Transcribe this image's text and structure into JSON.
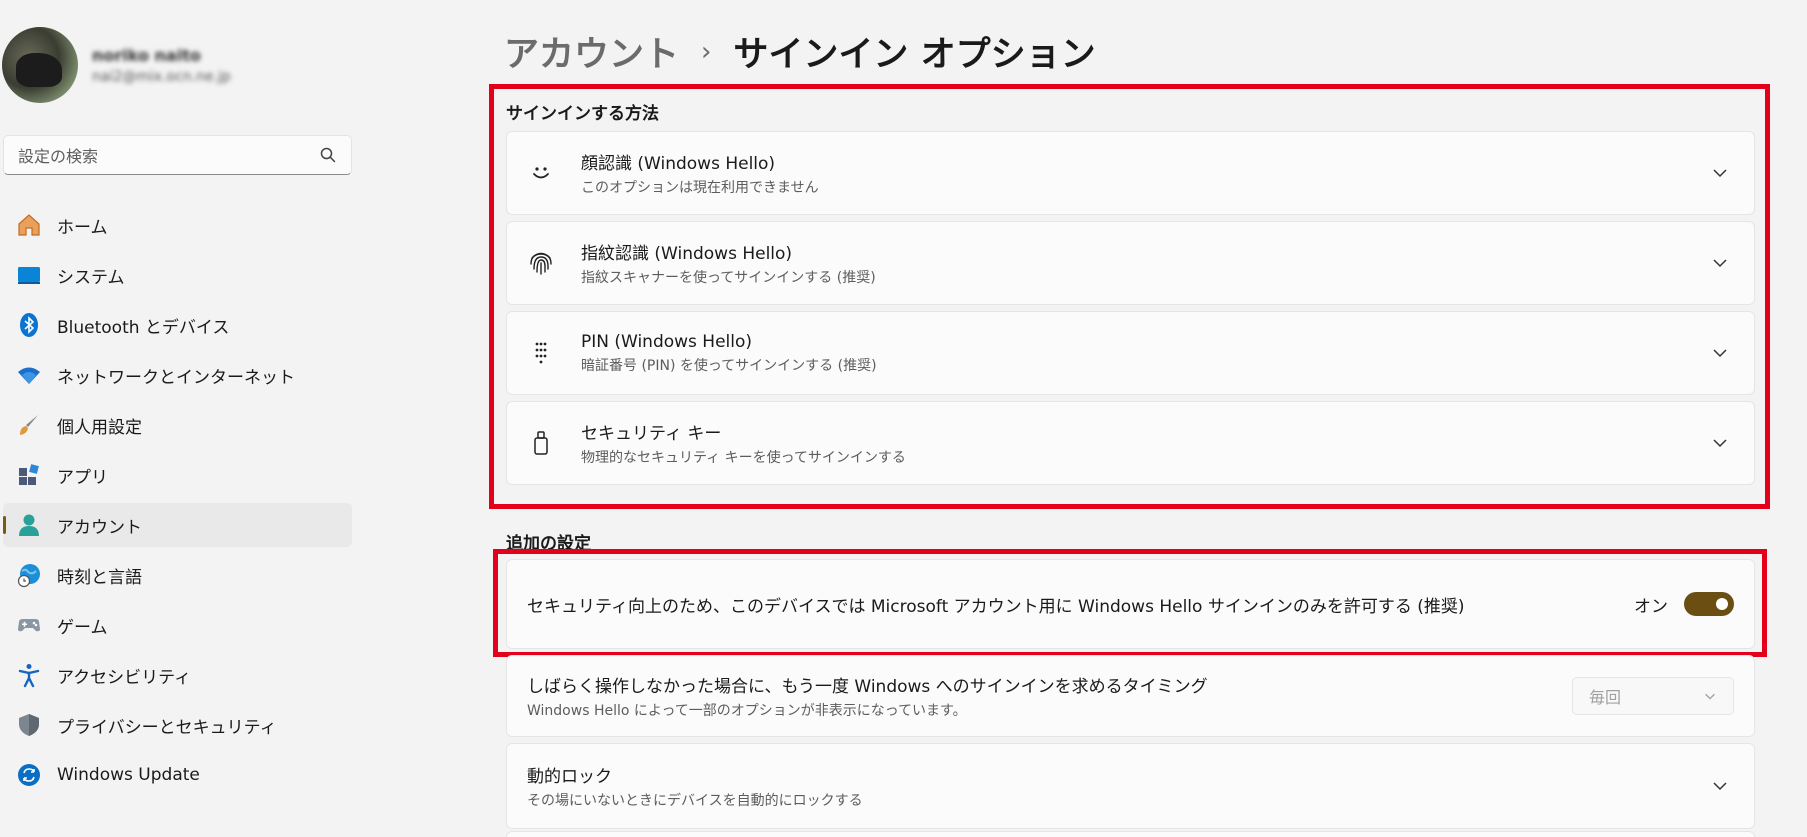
{
  "profile": {
    "name": "noriko naito",
    "email": "nai2@mix.ocn.ne.jp"
  },
  "search": {
    "placeholder": "設定の検索",
    "icon": "search-icon"
  },
  "nav": [
    {
      "label": "ホーム",
      "icon": "home-icon",
      "color": "#e07a2e"
    },
    {
      "label": "システム",
      "icon": "system-icon",
      "color": "#0078d4"
    },
    {
      "label": "Bluetooth とデバイス",
      "icon": "bluetooth-icon",
      "color": "#0078d4"
    },
    {
      "label": "ネットワークとインターネット",
      "icon": "wifi-icon",
      "color": "#1a6fc9"
    },
    {
      "label": "個人用設定",
      "icon": "brush-icon",
      "color": "#d98a2a"
    },
    {
      "label": "アプリ",
      "icon": "apps-icon",
      "color": "#4a5a78"
    },
    {
      "label": "アカウント",
      "icon": "account-icon",
      "color": "#2aa198",
      "active": true
    },
    {
      "label": "時刻と言語",
      "icon": "globe-clock-icon",
      "color": "#1e8fd6"
    },
    {
      "label": "ゲーム",
      "icon": "gamepad-icon",
      "color": "#6b7a8a"
    },
    {
      "label": "アクセシビリティ",
      "icon": "accessibility-icon",
      "color": "#1565c0"
    },
    {
      "label": "プライバシーとセキュリティ",
      "icon": "shield-icon",
      "color": "#6e7781"
    },
    {
      "label": "Windows Update",
      "icon": "update-icon",
      "color": "#0078d4"
    }
  ],
  "breadcrumb": {
    "parent": "アカウント",
    "separator": "›",
    "current": "サインイン オプション"
  },
  "signin": {
    "section_title": "サインインする方法",
    "items": [
      {
        "title": "顔認識 (Windows Hello)",
        "subtitle": "このオプションは現在利用できません",
        "icon": "face-icon"
      },
      {
        "title": "指紋認識 (Windows Hello)",
        "subtitle": "指紋スキャナーを使ってサインインする (推奨)",
        "icon": "fingerprint-icon"
      },
      {
        "title": "PIN (Windows Hello)",
        "subtitle": "暗証番号 (PIN) を使ってサインインする (推奨)",
        "icon": "pin-keypad-icon"
      },
      {
        "title": "セキュリティ キー",
        "subtitle": "物理的なセキュリティ キーを使ってサインインする",
        "icon": "usb-key-icon"
      }
    ]
  },
  "additional": {
    "section_title": "追加の設定",
    "hello_only": {
      "text": "セキュリティ向上のため、このデバイスでは Microsoft アカウント用に Windows Hello サインインのみを許可する (推奨)",
      "toggle_label": "オン",
      "toggle_on": true
    },
    "timeout": {
      "title": "しばらく操作しなかった場合に、もう一度 Windows へのサインインを求めるタイミング",
      "subtitle": "Windows Hello によって一部のオプションが非表示になっています。",
      "value": "毎回"
    },
    "dynamic_lock": {
      "title": "動的ロック",
      "subtitle": "その場にいないときにデバイスを自動的にロックする"
    }
  },
  "colors": {
    "accent": "#6b4e12",
    "highlight": "#e3001b"
  }
}
